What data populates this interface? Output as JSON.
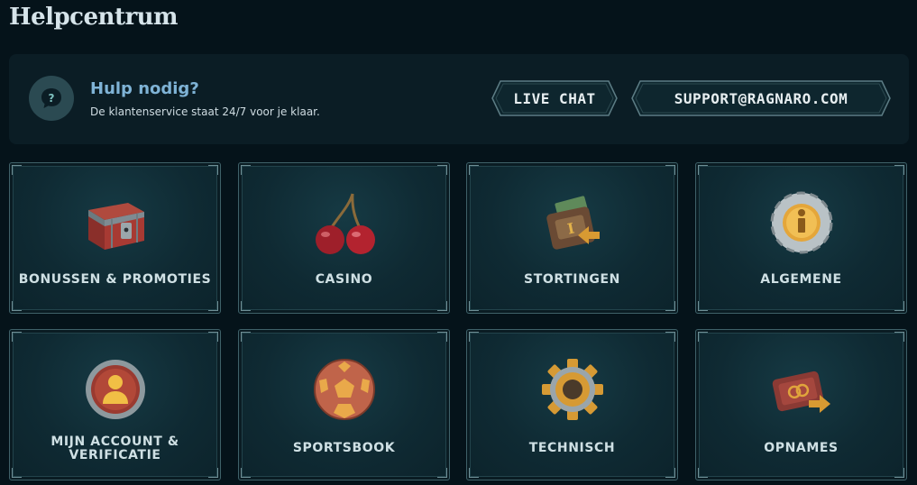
{
  "page": {
    "title": "Helpcentrum"
  },
  "help": {
    "heading": "Hulp nodig?",
    "subtext": "De klantenservice staat 24/7 voor je klaar.",
    "live_chat": "LIVE CHAT",
    "email": "SUPPORT@RAGNARO.COM"
  },
  "categories": [
    {
      "label": "BONUSSEN & PROMOTIES",
      "icon": "treasure-chest-icon"
    },
    {
      "label": "CASINO",
      "icon": "cherries-icon"
    },
    {
      "label": "STORTINGEN",
      "icon": "wallet-deposit-icon"
    },
    {
      "label": "ALGEMENE",
      "icon": "info-coin-icon"
    },
    {
      "label": "MIJN ACCOUNT &\nVERIFICATIE",
      "icon": "account-icon"
    },
    {
      "label": "SPORTSBOOK",
      "icon": "football-icon"
    },
    {
      "label": "TECHNISCH",
      "icon": "gear-icon"
    },
    {
      "label": "OPNAMES",
      "icon": "wallet-withdraw-icon"
    }
  ],
  "colors": {
    "background": "#05131a",
    "panel": "#0b1d25",
    "accent_text": "#7fb3d6"
  }
}
